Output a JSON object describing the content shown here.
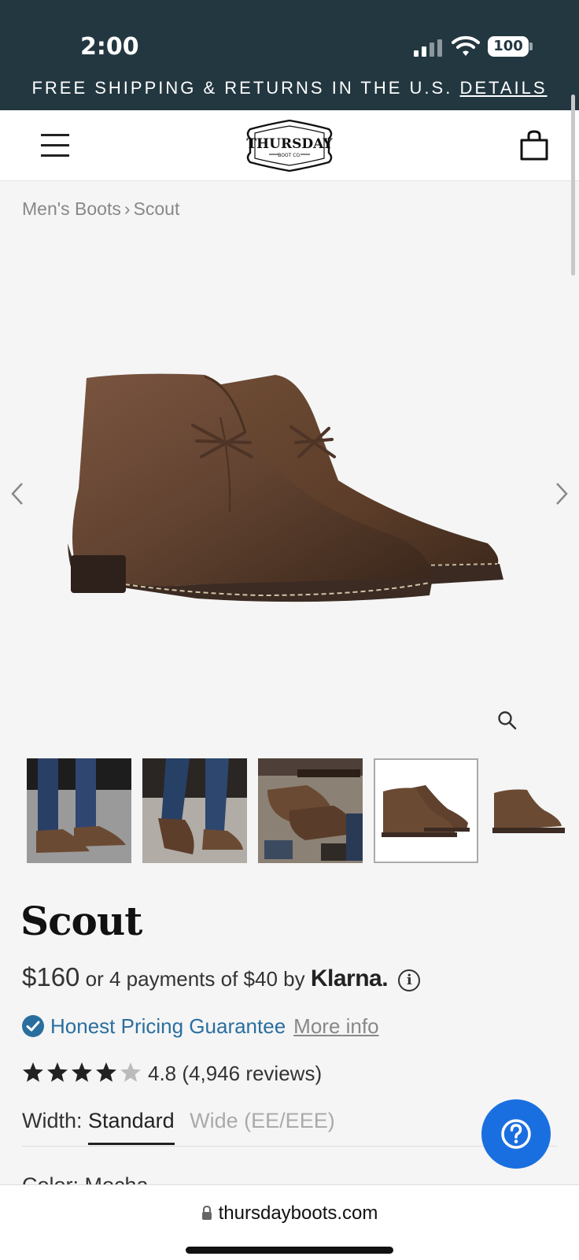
{
  "status_bar": {
    "time": "2:00",
    "battery": "100"
  },
  "promo": {
    "text": "Free shipping & returns in the U.S.",
    "link": "Details"
  },
  "header": {
    "logo_text": "THURSDAY",
    "logo_subtext": "BOOT CO."
  },
  "breadcrumb": {
    "parent": "Men's Boots",
    "separator": "›",
    "current": "Scout"
  },
  "product": {
    "title": "Scout",
    "price": "$160",
    "installments": "or 4 payments of $40 by",
    "klarna": "Klarna.",
    "guarantee": "Honest Pricing Guarantee",
    "more_info": "More info",
    "rating_value": 4.8,
    "rating_text": "4.8 (4,946 reviews)",
    "width_label": "Width:",
    "width_options": [
      "Standard",
      "Wide (EE/EEE)"
    ],
    "color_label": "Color: Mocha"
  },
  "thumbnails": [
    {
      "name": "on-foot-front"
    },
    {
      "name": "on-foot-walking"
    },
    {
      "name": "flat-lay"
    },
    {
      "name": "pair-side",
      "selected": true
    },
    {
      "name": "single-side"
    }
  ],
  "browser": {
    "url": "thursdayboots.com"
  },
  "colors": {
    "status_bg": "#233740",
    "accent_blue": "#1a6fe0",
    "link_blue": "#2a6ea0",
    "boot_brown": "#6b4a33"
  }
}
